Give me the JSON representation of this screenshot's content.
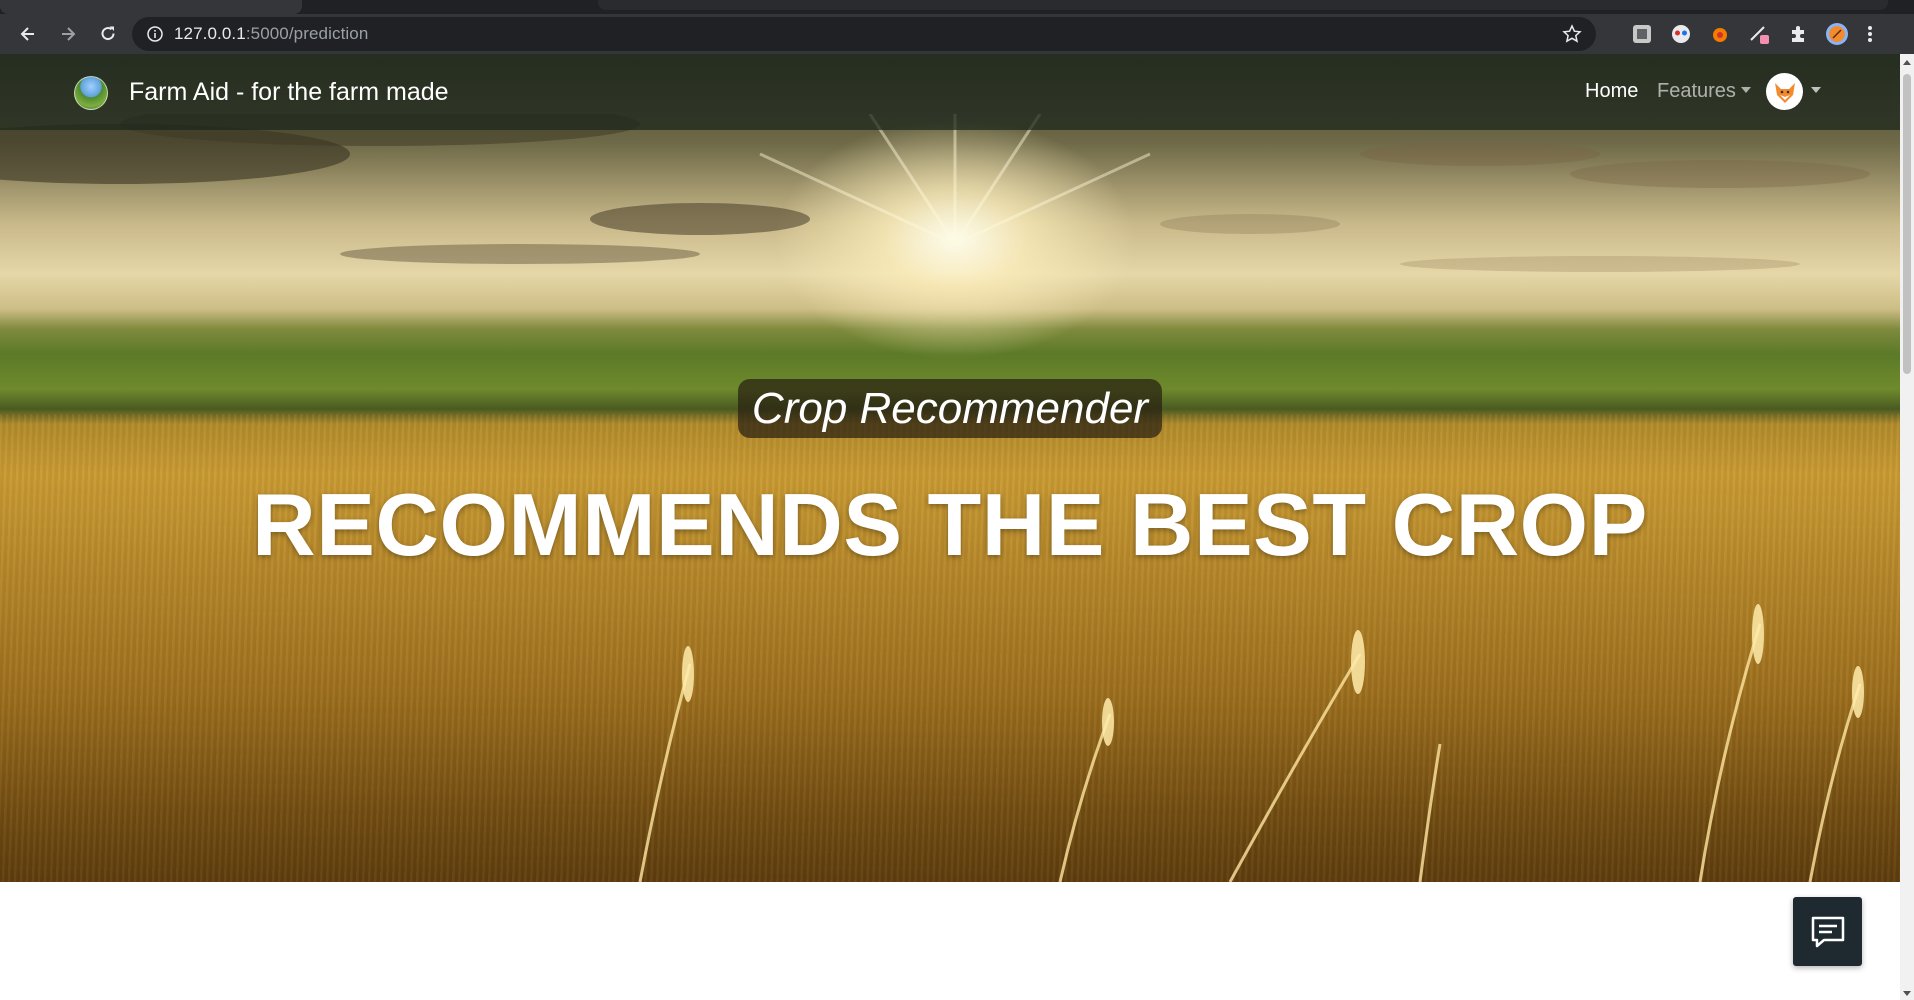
{
  "browser": {
    "url_host": "127.0.0.1",
    "url_path": ":5000/prediction"
  },
  "navbar": {
    "brand": "Farm Aid - for the farm made",
    "links": {
      "home": "Home",
      "features": "Features"
    }
  },
  "hero": {
    "subtitle": "Crop Recommender",
    "title": "RECOMMENDS THE BEST CROP"
  },
  "colors": {
    "navbar_bg": "#1c261c",
    "chat_button_bg": "#1f2a30",
    "browser_toolbar": "#35363a"
  },
  "icons": {
    "back": "back-arrow-icon",
    "forward": "forward-arrow-icon",
    "reload": "reload-icon",
    "info": "info-icon",
    "star": "star-icon",
    "extensions": "puzzle-icon",
    "menu": "kebab-menu-icon",
    "chat": "chat-icon"
  }
}
